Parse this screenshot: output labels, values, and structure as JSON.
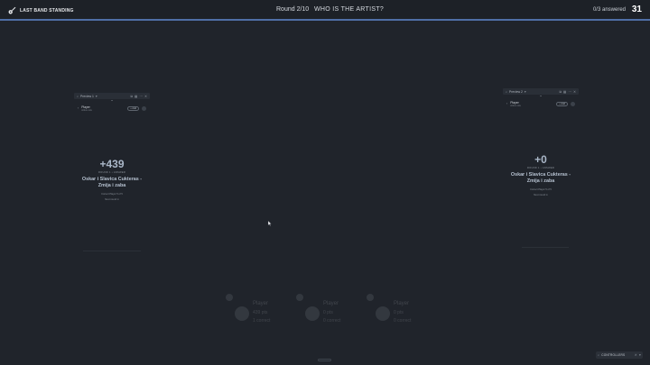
{
  "app": {
    "logo_text": "Last Band Standing"
  },
  "header": {
    "round": "Round 2/10",
    "question": "WHO IS THE ARTIST?",
    "answered": "0/3 answered",
    "timer": "31"
  },
  "previews": [
    {
      "title": "Preview 1",
      "player_name": "Player",
      "player_sub": "Active now",
      "pill": "+ Add",
      "score": "+439",
      "score_sub": "ROUND 1 • ANSWER",
      "song_line1": "Oskar i Slavica Cukteras -",
      "song_line2": "Zmija i zaba",
      "note1": "Correct Player 5 of 5",
      "note2": "Next round in"
    },
    {
      "title": "Preview 2",
      "player_name": "Player",
      "player_sub": "Active now",
      "pill": "+ Add",
      "score": "+0",
      "score_sub": "ROUND 1 • ANSWER",
      "song_line1": "Oskar i Slavica Cukteras -",
      "song_line2": "Zmija i zaba",
      "note1": "Correct Player 5 of 5",
      "note2": "Next round in"
    }
  ],
  "players": [
    {
      "name": "Player",
      "line1": "439 pts",
      "line2": "1 correct"
    },
    {
      "name": "Player",
      "line1": "0 pts",
      "line2": "0 correct"
    },
    {
      "name": "Player",
      "line1": "0 pts",
      "line2": "0 correct"
    }
  ],
  "controllers": {
    "label": "CONTROLLERS"
  },
  "colors": {
    "accent": "#4f6fa6",
    "background": "#20242b"
  }
}
